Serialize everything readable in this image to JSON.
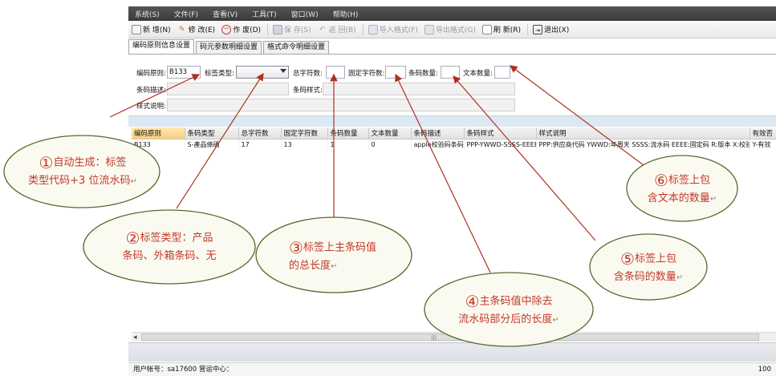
{
  "menu": [
    "系统(S)",
    "文件(F)",
    "查看(V)",
    "工具(T)",
    "窗口(W)",
    "帮助(H)"
  ],
  "toolbar": {
    "new": "新 增(N)",
    "edit": "修 改(E)",
    "void": "作 废(D)",
    "save": "保 存(S)",
    "back": "返 回(B)",
    "import": "导入格式(F)",
    "export": "导出格式(G)",
    "refresh": "刷 新(R)",
    "exit": "退出(X)"
  },
  "tabs": [
    "编码原则信息设置",
    "码元参数明细设置",
    "格式命令明细设置"
  ],
  "form": {
    "rule_label": "编码原则:",
    "rule_value": "B133",
    "label_type_label": "标签类型:",
    "total_chars_label": "总字符数:",
    "fixed_chars_label": "固定字符数:",
    "barcode_count_label": "条码数量:",
    "text_count_label": "文本数量:",
    "barcode_desc_label": "条码描述:",
    "barcode_style_label": "条码样式:",
    "style_desc_label": "样式说明:"
  },
  "grid": {
    "headers": [
      "编码原则",
      "条码类型",
      "总字符数",
      "固定字符数",
      "条码数量",
      "文本数量",
      "条码描述",
      "条码样式",
      "样式说明",
      "有效否"
    ],
    "row": [
      "B133",
      "S-產品條碼",
      "17",
      "13",
      "1",
      "0",
      "apple校验码条码",
      "PPP-YWWD-SSSS-EEEE-R-X",
      "PPP:供应商代码 YWWD:年周天 SSSS:流水码 EEEE:固定码 R:版本 X:校验码",
      "Y-有效"
    ]
  },
  "status": {
    "left": "用户帐号：sa17600   营运中心：",
    "right": "100"
  },
  "callouts": {
    "c1_num": "①",
    "c1_line1": "自动生成：标签",
    "c1_line2": "类型代码+3 位流水码",
    "c2_num": "②",
    "c2_line1": "标签类型：产品",
    "c2_line2": "条码、外箱条码、无",
    "c3_num": "③",
    "c3_line1": "标签上主条码值",
    "c3_line2": "的总长度",
    "c4_num": "④",
    "c4_line1": "主条码值中除去",
    "c4_line2": "流水码部分后的长度",
    "c5_num": "⑤",
    "c5_line1": "标签上包",
    "c5_line2": "含条码的数量",
    "c6_num": "⑥",
    "c6_line1": "标签上包",
    "c6_line2": "含文本的数量",
    "return_mark": "↵"
  },
  "colors": {
    "callout_text": "#c0392b",
    "ellipse_fill": "#fbfaf0",
    "ellipse_stroke": "#556b2f",
    "arrow": "#b03020"
  }
}
